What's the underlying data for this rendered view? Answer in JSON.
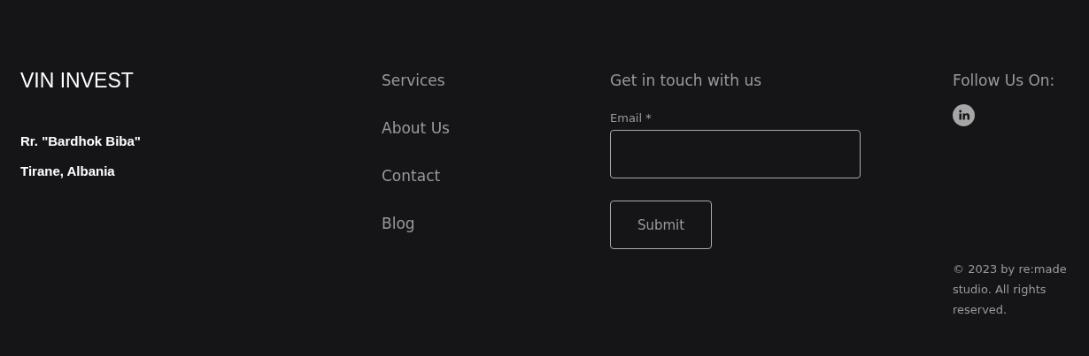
{
  "brand": {
    "name": "VIN INVEST",
    "address_lines": [
      "Rr. \"Bardhok Biba\"",
      "Tirane, Albania"
    ]
  },
  "nav_links": [
    "Services",
    "About Us",
    "Contact",
    "Blog"
  ],
  "contact_form": {
    "heading": "Get in touch with us",
    "email_label": "Email *",
    "submit": "Submit"
  },
  "social": {
    "heading": "Follow Us On:",
    "copyright": "© 2023 by re:made studio. All rights reserved."
  }
}
